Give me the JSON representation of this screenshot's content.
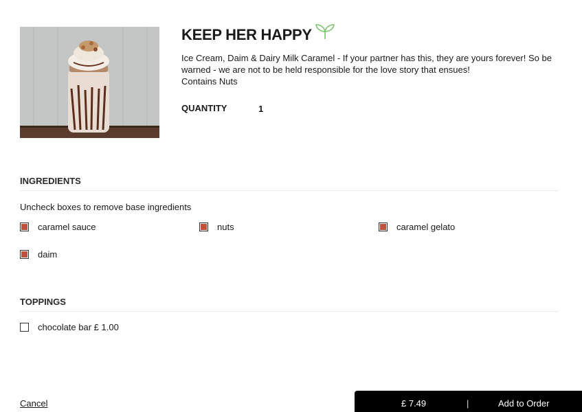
{
  "product": {
    "title": "KEEP HER HAPPY",
    "description": "Ice Cream, Daim & Dairy Milk Caramel - If your partner has this, they are yours forever! So be warned - we are not to be held responsible for the love story that ensues!",
    "allergen_note": "Contains Nuts",
    "image_icon": "milkshake-jar-photo",
    "badge_icon": "leaf-sprout-icon",
    "badge_color": "#7cc36e"
  },
  "quantity": {
    "label": "QUANTITY",
    "value": "1"
  },
  "ingredients": {
    "heading": "INGREDIENTS",
    "hint": "Uncheck boxes to remove base ingredients",
    "items": [
      {
        "label": "caramel sauce",
        "checked": true
      },
      {
        "label": "nuts",
        "checked": true
      },
      {
        "label": "caramel gelato",
        "checked": true
      },
      {
        "label": "daim",
        "checked": true
      }
    ]
  },
  "toppings": {
    "heading": "TOPPINGS",
    "items": [
      {
        "label": "chocolate bar £ 1.00",
        "checked": false
      }
    ]
  },
  "footer": {
    "cancel_label": "Cancel",
    "price": "£ 7.49",
    "separator": "|",
    "add_label": "Add to Order"
  },
  "colors": {
    "check_fill": "#c0513a",
    "order_bar": "#000000"
  }
}
